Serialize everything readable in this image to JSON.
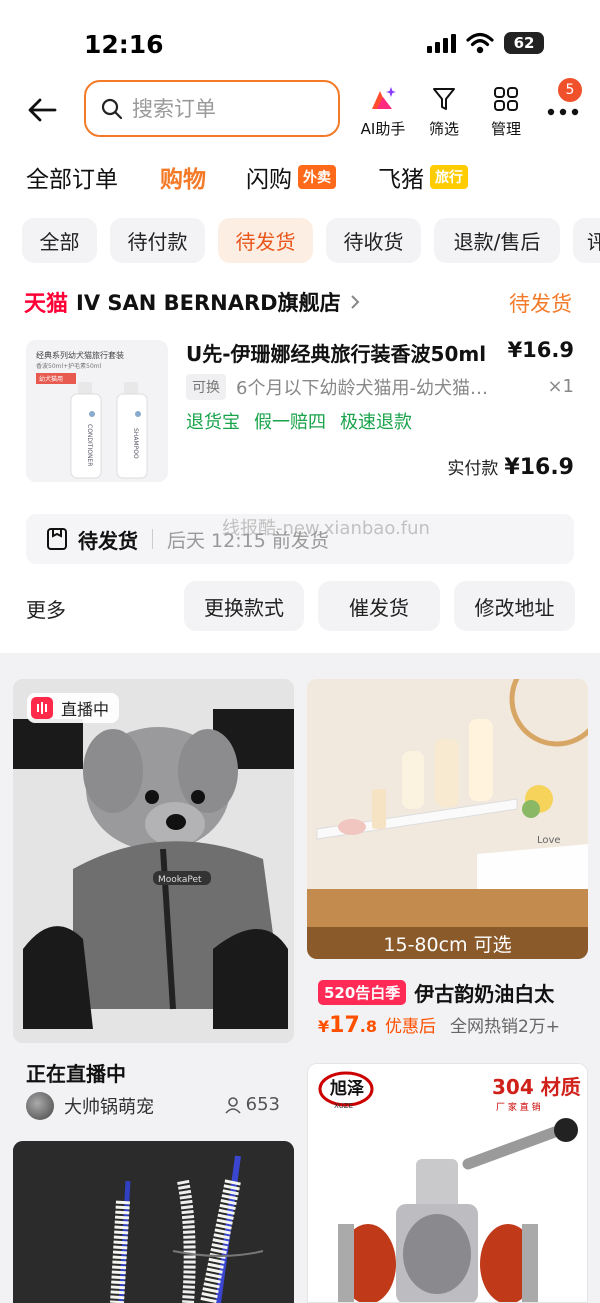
{
  "status_bar": {
    "time": "12:16",
    "battery": "62"
  },
  "header": {
    "search_placeholder": "搜索订单",
    "actions": [
      {
        "label": "AI助手",
        "icon": "ai-sparkle-icon"
      },
      {
        "label": "筛选",
        "icon": "filter-icon"
      },
      {
        "label": "管理",
        "icon": "grid-icon"
      }
    ],
    "more_badge": "5"
  },
  "category_tabs": [
    {
      "label": "全部订单",
      "active": false
    },
    {
      "label": "购物",
      "active": true
    },
    {
      "label": "闪购",
      "tag": "外卖"
    },
    {
      "label": "飞猪",
      "tag": "旅行"
    }
  ],
  "filter_pills": [
    {
      "label": "全部"
    },
    {
      "label": "待付款"
    },
    {
      "label": "待发货",
      "active": true
    },
    {
      "label": "待收货"
    },
    {
      "label": "退款/售后"
    },
    {
      "label": "评"
    }
  ],
  "order": {
    "platform": "天猫",
    "shop_name": "IV SAN BERNARD旗舰店",
    "status": "待发货",
    "image_lines": [
      "经典系列幼犬猫旅行套装",
      "香波50ml+护毛素50ml",
      "幼犬猫用",
      "CONDITIONER",
      "SHAMPOO"
    ],
    "title": "U先-伊珊娜经典旅行装香波50ml",
    "price": "¥16.9",
    "variant_tag": "可换",
    "variant": "6个月以下幼龄犬猫用-幼犬猫…",
    "quantity": "×1",
    "services": [
      "退货宝",
      "假一赔四",
      "极速退款"
    ],
    "paid_label": "实付款",
    "paid_amount": "¥16.9",
    "ship_label": "待发货",
    "ship_time": "后天 12:15 前发货",
    "watermark": "线报酷-new.xianbao.fun",
    "more_label": "更多",
    "buttons": [
      "更换款式",
      "催发货",
      "修改地址"
    ]
  },
  "feed": {
    "live": {
      "badge": "直播中",
      "title": "正在直播中",
      "author": "大帅锅萌宠",
      "viewers": "653",
      "jacket_text": "MookaPet"
    },
    "product": {
      "caption": "15-80cm 可选",
      "promo_tag": "520告白季",
      "title": "伊古韵奶油白太",
      "price_symbol": "¥",
      "price_int": "17",
      "price_dec": ".8",
      "price_note": "优惠后",
      "sales": "全网热销2万+",
      "decor_text": "Love"
    },
    "valve": {
      "brand": "旭泽",
      "brand_sub": "XUZE",
      "headline": "304 材质",
      "subline": "厂 家 直 销"
    }
  },
  "colors": {
    "accent": "#f47a28",
    "tmall": "#ff0036",
    "green": "#19a34a",
    "price": "#ff5000"
  }
}
